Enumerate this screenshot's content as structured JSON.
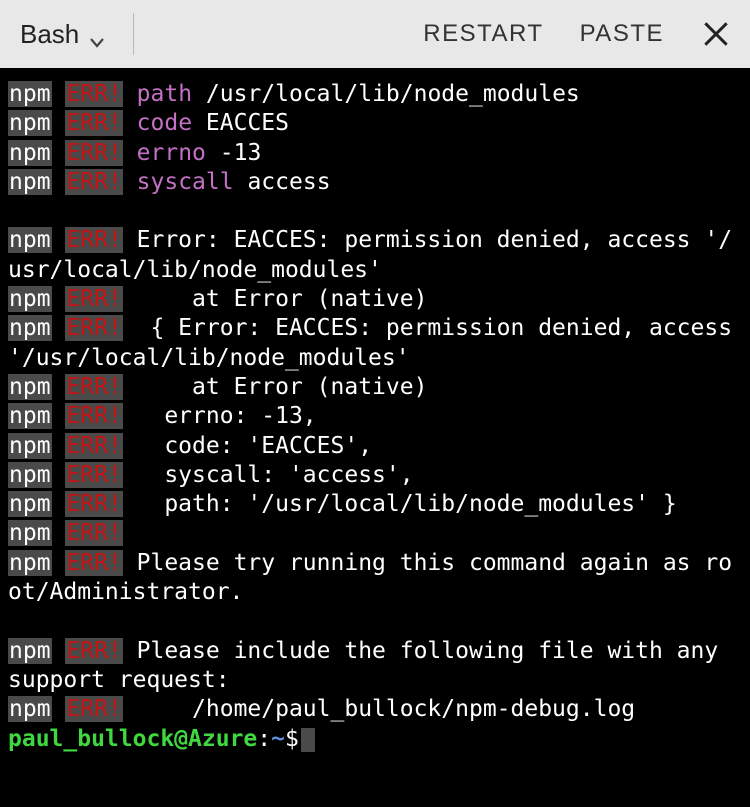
{
  "toolbar": {
    "shell_label": "Bash",
    "restart_label": "RESTART",
    "paste_label": "PASTE"
  },
  "term": {
    "npm": "npm",
    "err": "ERR!",
    "keys": {
      "path": "path",
      "code": "code",
      "errno": "errno",
      "syscall": "syscall"
    },
    "vals": {
      "path": "/usr/local/lib/node_modules",
      "code": "EACCES",
      "errno": "-13",
      "syscall": "access"
    },
    "lines": {
      "l1": " Error: EACCES: permission denied, access '/usr/local/lib/node_modules'",
      "l2": "     at Error (native)",
      "l3": "  { Error: EACCES: permission denied, access '/usr/local/lib/node_modules'",
      "l4": "     at Error (native)",
      "l5": "   errno: -13,",
      "l6": "   code: 'EACCES',",
      "l7": "   syscall: 'access',",
      "l8": "   path: '/usr/local/lib/node_modules' }",
      "l9": " Please try running this command again as root/Administrator.",
      "l10": " Please include the following file with any support request:",
      "l11": "     /home/paul_bullock/npm-debug.log"
    },
    "prompt": {
      "user": "paul_bullock",
      "at": "@",
      "host": "Azure",
      "colon": ":",
      "tilde": "~",
      "dollar": "$"
    }
  }
}
